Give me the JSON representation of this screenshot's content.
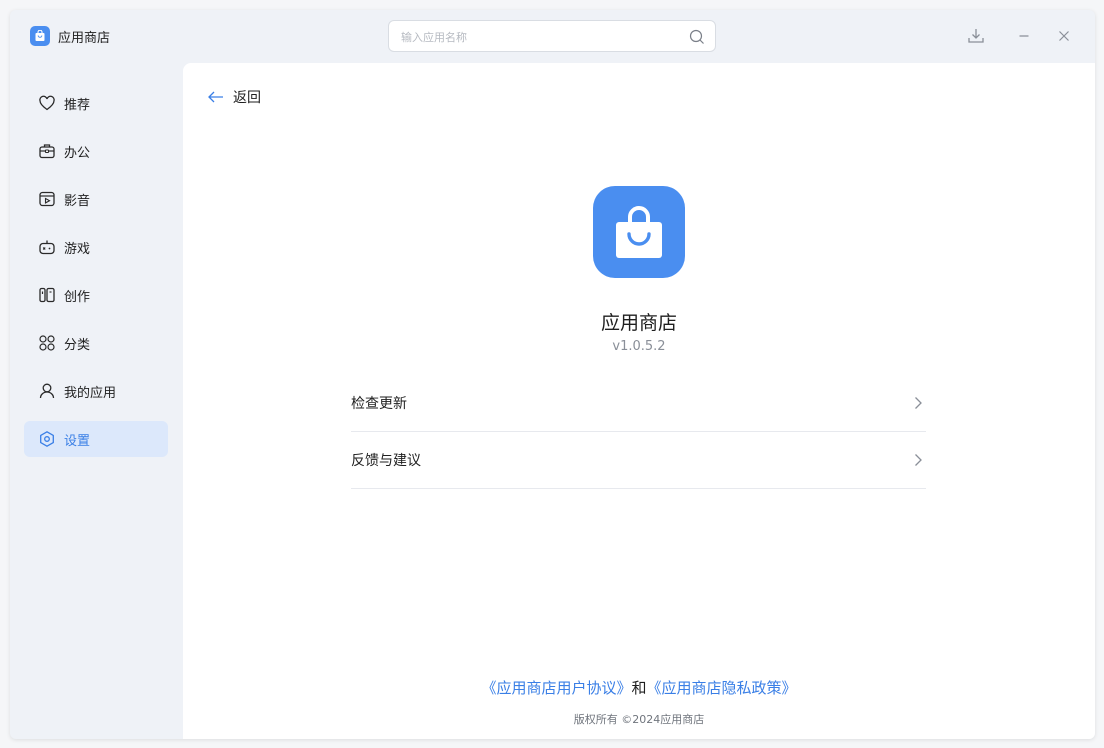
{
  "app": {
    "name": "应用商店",
    "version": "v1.0.5.2"
  },
  "search": {
    "placeholder": "输入应用名称"
  },
  "sidebar": {
    "items": [
      {
        "label": "推荐",
        "icon": "heart-icon"
      },
      {
        "label": "办公",
        "icon": "briefcase-icon"
      },
      {
        "label": "影音",
        "icon": "video-icon"
      },
      {
        "label": "游戏",
        "icon": "gamepad-icon"
      },
      {
        "label": "创作",
        "icon": "book-icon"
      },
      {
        "label": "分类",
        "icon": "grid-icon"
      },
      {
        "label": "我的应用",
        "icon": "user-icon"
      },
      {
        "label": "设置",
        "icon": "settings-icon",
        "active": true
      }
    ]
  },
  "main": {
    "back_label": "返回",
    "menu": [
      {
        "label": "检查更新"
      },
      {
        "label": "反馈与建议"
      }
    ],
    "legal": {
      "user_agreement": "《应用商店用户协议》",
      "and": "和",
      "privacy_policy": "《应用商店隐私政策》"
    },
    "copyright": "版权所有 ©2024应用商店"
  },
  "colors": {
    "accent": "#4a8ef0",
    "link": "#3a7fe6",
    "active_bg": "#dce8fb"
  }
}
